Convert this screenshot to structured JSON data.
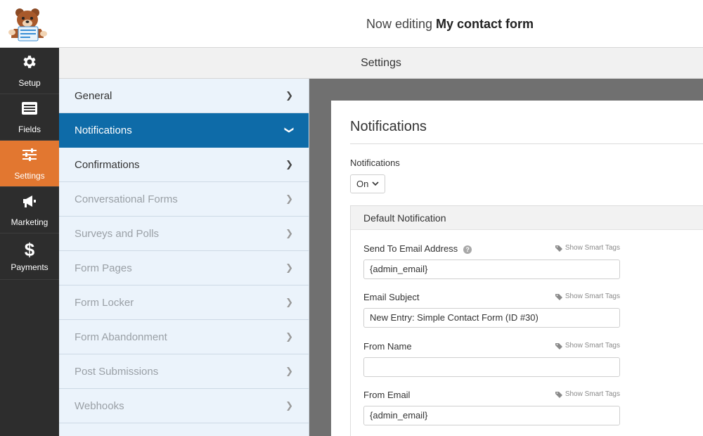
{
  "header": {
    "editing_prefix": "Now editing",
    "form_name": "My contact form"
  },
  "sidebar": {
    "items": [
      {
        "label": "Setup",
        "icon": "gear-icon"
      },
      {
        "label": "Fields",
        "icon": "fields-list-icon"
      },
      {
        "label": "Settings",
        "icon": "sliders-icon",
        "active": true
      },
      {
        "label": "Marketing",
        "icon": "megaphone-icon"
      },
      {
        "label": "Payments",
        "icon": "dollar-icon"
      }
    ]
  },
  "settings_header": {
    "title": "Settings"
  },
  "panels": {
    "items": [
      {
        "label": "General"
      },
      {
        "label": "Notifications",
        "active": true
      },
      {
        "label": "Confirmations"
      },
      {
        "label": "Conversational Forms",
        "disabled": true
      },
      {
        "label": "Surveys and Polls",
        "disabled": true
      },
      {
        "label": "Form Pages",
        "disabled": true
      },
      {
        "label": "Form Locker",
        "disabled": true
      },
      {
        "label": "Form Abandonment",
        "disabled": true
      },
      {
        "label": "Post Submissions",
        "disabled": true
      },
      {
        "label": "Webhooks",
        "disabled": true
      }
    ]
  },
  "content": {
    "title": "Notifications",
    "notifications_label": "Notifications",
    "notifications_value": "On",
    "block_title": "Default Notification",
    "smart_tags_label": "Show Smart Tags",
    "fields": [
      {
        "label": "Send To Email Address",
        "value": "{admin_email}",
        "help": true
      },
      {
        "label": "Email Subject",
        "value": "New Entry: Simple Contact Form (ID #30)"
      },
      {
        "label": "From Name",
        "value": ""
      },
      {
        "label": "From Email",
        "value": "{admin_email}"
      }
    ]
  },
  "colors": {
    "sidebar_bg": "#2d2d2d",
    "active_sidebar": "#e27730",
    "active_panel": "#0e6ba8",
    "panel_bg": "#ebf3fb"
  }
}
